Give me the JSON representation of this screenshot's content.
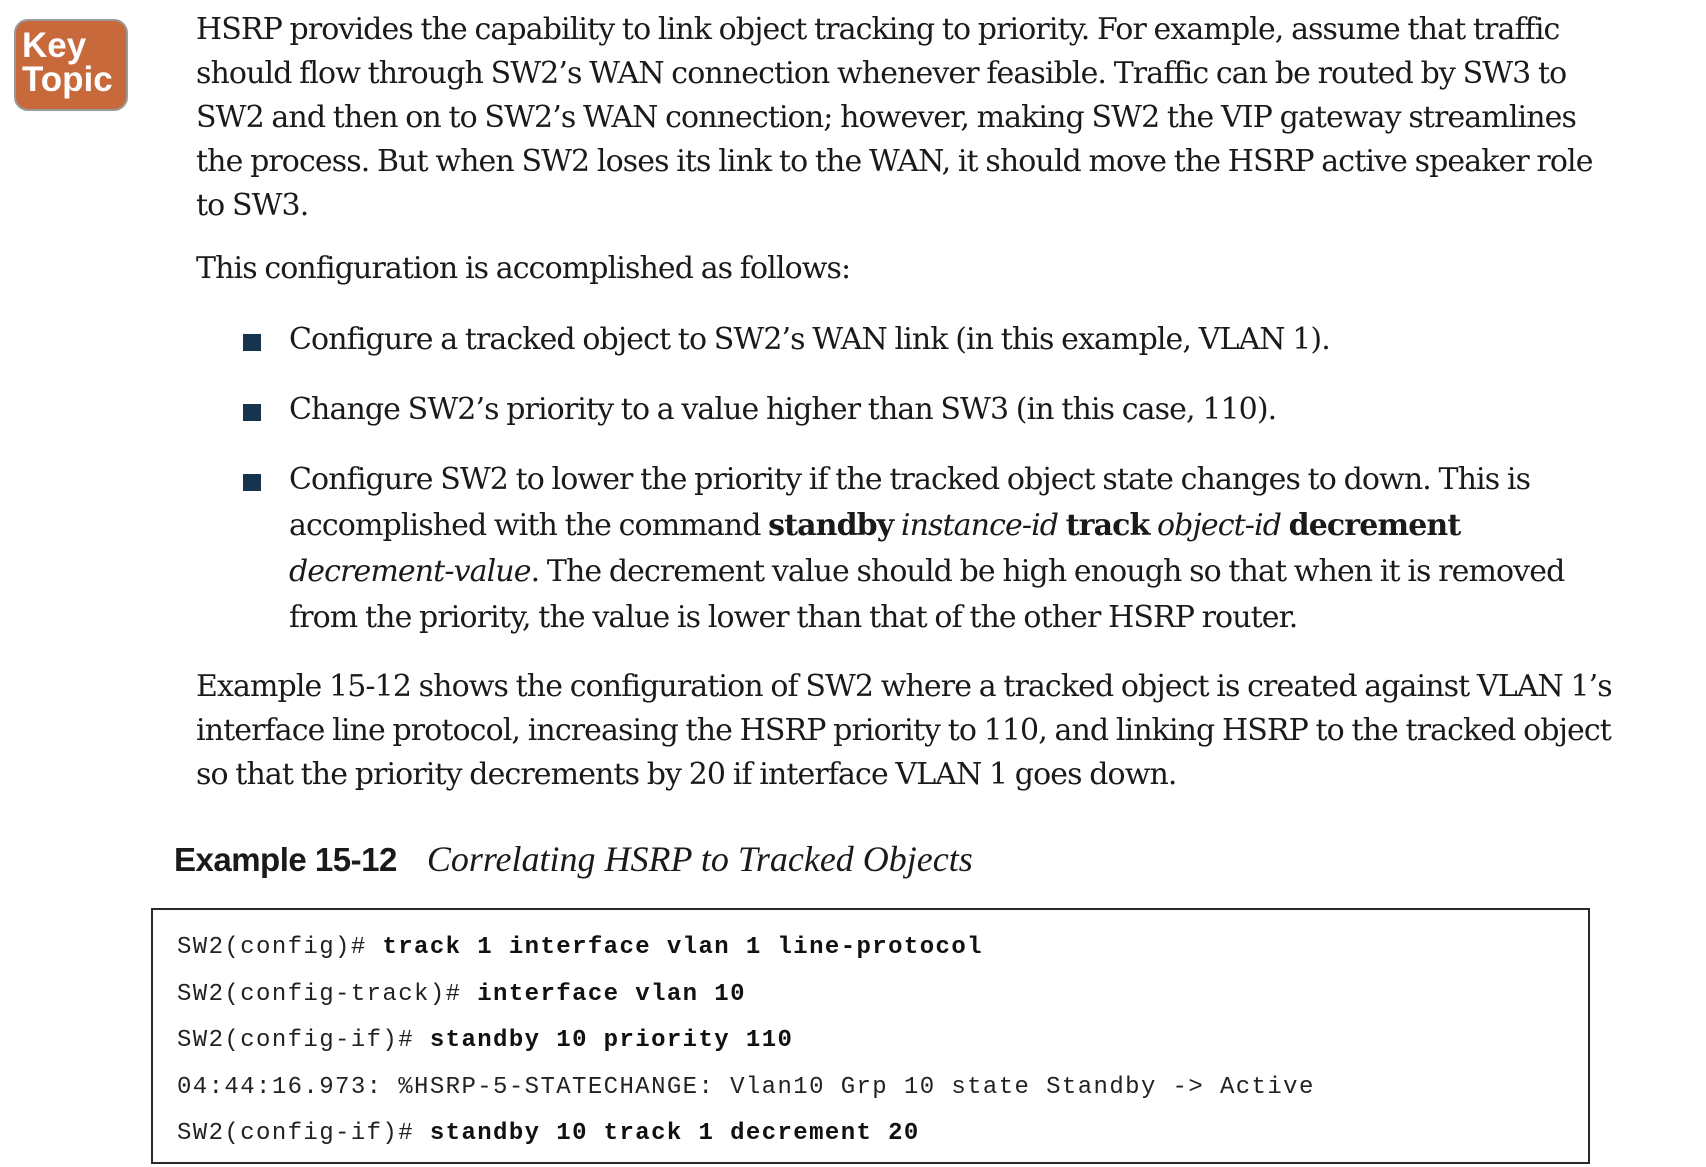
{
  "badge": {
    "line1": "Key",
    "line2": "Topic",
    "color": "#c8693b"
  },
  "intro": {
    "paragraph": "HSRP provides the capability to link object tracking to priority. For example, assume that traffic should flow through SW2’s WAN connection whenever feasible. Traffic can be routed by SW3 to SW2 and then on to SW2’s WAN connection; however, making SW2 the VIP gateway streamlines the process. But when SW2 loses its link to the WAN, it should move the HSRP active speaker role to SW3.",
    "lead_in": "This configuration is accomplished as follows:"
  },
  "bullets": {
    "item1": "Configure a tracked object to SW2’s WAN link (in this example, VLAN 1).",
    "item2": "Change SW2’s priority to a value higher than SW3 (in this case, 110).",
    "item3": {
      "text_before": "Configure SW2 to lower the priority if the tracked object state changes to down. This is accomplished with the command ",
      "cmd_standby": "standby",
      "arg_instance": "instance-id",
      "cmd_track": "track",
      "arg_object": "object-id",
      "cmd_decrement": "decrement",
      "arg_decrement": "decrement-value",
      "text_after": ". The decrement value should be high enough so that when it is removed from the priority, the value is lower than that of the other HSRP router."
    }
  },
  "summary": "Example 15-12 shows the configuration of SW2 where a tracked object is created against VLAN 1’s interface line protocol, increasing the HSRP priority to 110, and linking HSRP to the tracked object so that the priority decrements by 20 if interface VLAN 1 goes down.",
  "example": {
    "label": "Example 15-12",
    "title": "Correlating HSRP to Tracked Objects",
    "code": [
      {
        "prompt": "SW2(config)# ",
        "command": "track 1 interface vlan 1 line-protocol"
      },
      {
        "prompt": "SW2(config-track)# ",
        "command": "interface vlan 10"
      },
      {
        "prompt": "SW2(config-if)# ",
        "command": "standby 10 priority 110"
      },
      {
        "prompt": "04:44:16.973: %HSRP-5-STATECHANGE: Vlan10 Grp 10 state Standby -> Active",
        "command": ""
      },
      {
        "prompt": "SW2(config-if)# ",
        "command": "standby 10 track 1 decrement 20"
      }
    ]
  },
  "colors": {
    "bullet_square": "#17344f",
    "text": "#1a1a1a"
  }
}
